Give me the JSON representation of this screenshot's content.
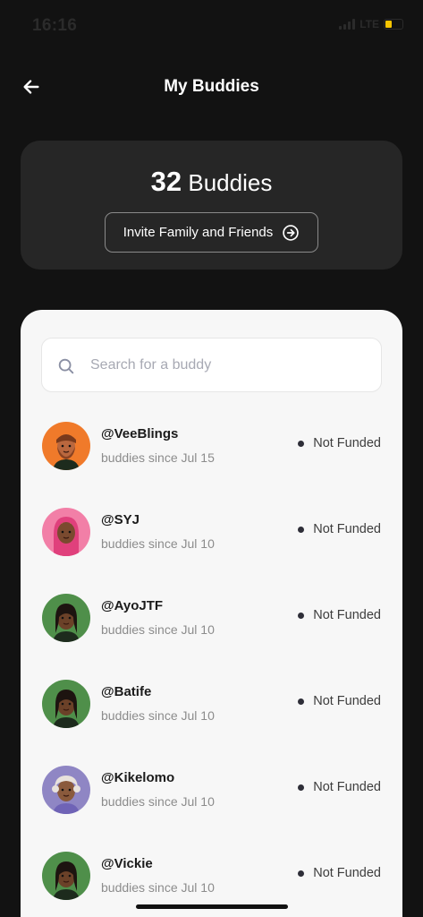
{
  "status_bar": {
    "time": "16:16",
    "network": "LTE",
    "battery_color": "#f5c400"
  },
  "header": {
    "title": "My Buddies",
    "back_icon": "arrow-left-icon"
  },
  "summary": {
    "count": "32",
    "count_label": "Buddies",
    "invite_label": "Invite Family and Friends",
    "invite_icon": "circle-arrow-right-icon"
  },
  "search": {
    "placeholder": "Search for a buddy",
    "value": "",
    "icon": "search-icon"
  },
  "buddies": [
    {
      "handle": "@VeeBlings",
      "since": "buddies since Jul 15",
      "status": "Not Funded",
      "avatar_bg": "#f07a2a",
      "avatar_style": "beard"
    },
    {
      "handle": "@SYJ",
      "since": "buddies since Jul 10",
      "status": "Not Funded",
      "avatar_bg": "#f27fa7",
      "avatar_style": "hijab"
    },
    {
      "handle": "@AyoJTF",
      "since": "buddies since Jul 10",
      "status": "Not Funded",
      "avatar_bg": "#4f8f4a",
      "avatar_style": "braids"
    },
    {
      "handle": "@Batife",
      "since": "buddies since Jul 10",
      "status": "Not Funded",
      "avatar_bg": "#4f8f4a",
      "avatar_style": "braids"
    },
    {
      "handle": "@Kikelomo",
      "since": "buddies since Jul 10",
      "status": "Not Funded",
      "avatar_bg": "#8f86c4",
      "avatar_style": "elder"
    },
    {
      "handle": "@Vickie",
      "since": "buddies since Jul 10",
      "status": "Not Funded",
      "avatar_bg": "#4f8f4a",
      "avatar_style": "braids"
    }
  ],
  "colors": {
    "background": "#121212",
    "card": "#262626",
    "panel": "#f7f7f7",
    "status_dot": "#2e2e38"
  }
}
